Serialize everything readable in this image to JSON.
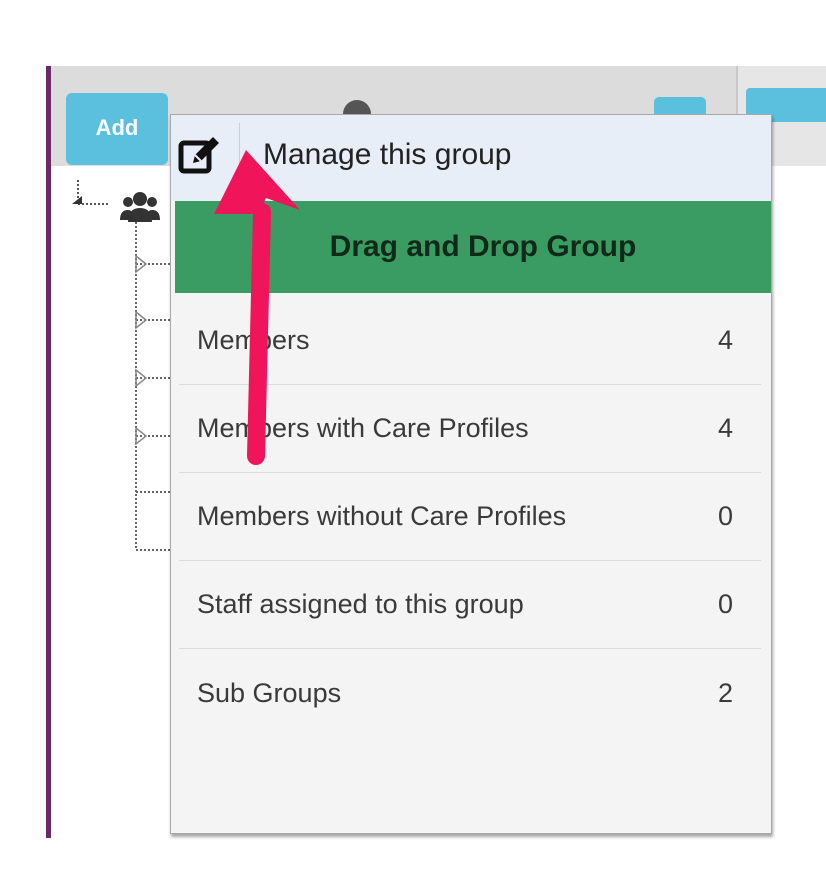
{
  "toolbar": {
    "add_label": "Add"
  },
  "popover": {
    "manage_label": "Manage this group",
    "group_name": "Drag and Drop Group",
    "stats": [
      {
        "label": "Members",
        "value": "4"
      },
      {
        "label": "Members with Care Profiles",
        "value": "4"
      },
      {
        "label": "Members without Care Profiles",
        "value": "0"
      },
      {
        "label": "Staff assigned to this group",
        "value": "0"
      },
      {
        "label": "Sub Groups",
        "value": "2"
      }
    ]
  },
  "colors": {
    "accent_blue": "#5bc0de",
    "group_green": "#3a9c62",
    "annotation_arrow": "#f0145a"
  },
  "icons": [
    "edit-icon",
    "group-icon"
  ]
}
